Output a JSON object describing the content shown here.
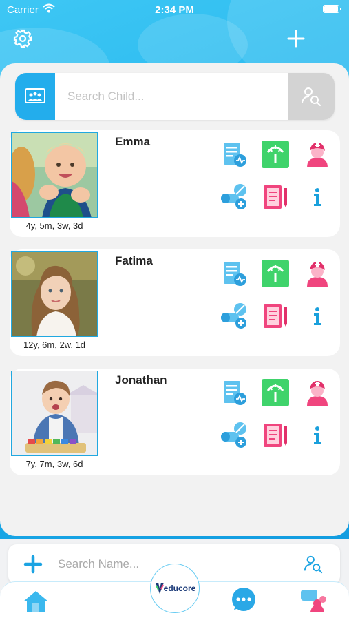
{
  "status_bar": {
    "carrier": "Carrier",
    "time": "2:34 PM"
  },
  "header": {
    "settings_icon": "gear-icon",
    "add_icon": "plus-icon"
  },
  "child_search": {
    "placeholder": "Search Child...",
    "left_icon": "classroom-board-icon",
    "right_icon": "find-person-icon"
  },
  "children": [
    {
      "name": "Emma",
      "age": "4y, 5m, 3w, 3d"
    },
    {
      "name": "Fatima",
      "age": "12y, 6m, 2w, 1d"
    },
    {
      "name": "Jonathan",
      "age": "7y, 7m, 3w, 6d"
    }
  ],
  "card_actions": [
    "report-icon",
    "growth-scale-icon",
    "nurse-icon",
    "medication-icon",
    "notebook-icon",
    "info-icon"
  ],
  "name_search": {
    "placeholder": "Search Name...",
    "left_icon": "plus-icon",
    "right_icon": "find-person-icon"
  },
  "tab_bar": {
    "logo_text": "educore",
    "tabs": [
      "home-icon",
      "chat-icon",
      "group-chat-icon"
    ]
  },
  "colors": {
    "accent": "#22b4ee",
    "green": "#3fd36b",
    "pink": "#f0457e",
    "icon_blue": "#37b3e8"
  }
}
